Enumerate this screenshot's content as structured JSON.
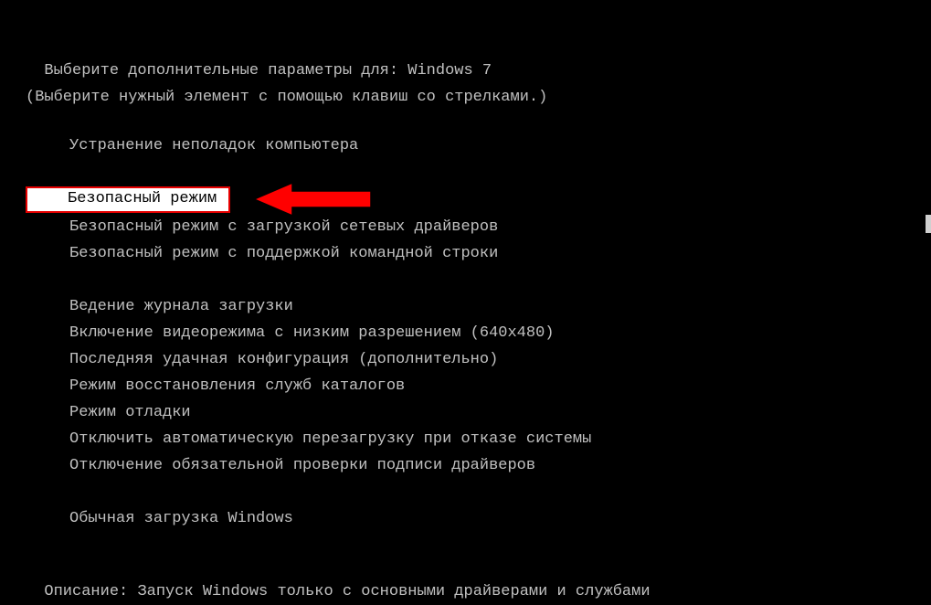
{
  "header": {
    "line1_prefix": "Выберите дополнительные параметры для: ",
    "os_name": "Windows 7",
    "line2": "(Выберите нужный элемент с помощью клавиш со стрелками.)"
  },
  "menu": {
    "repair": "Устранение неполадок компьютера",
    "safe_mode": "Безопасный режим",
    "safe_mode_net": "Безопасный режим с загрузкой сетевых драйверов",
    "safe_mode_cmd": "Безопасный режим с поддержкой командной строки",
    "boot_log": "Ведение журнала загрузки",
    "low_res": "Включение видеорежима с низким разрешением (640x480)",
    "last_known": "Последняя удачная конфигурация (дополнительно)",
    "ds_restore": "Режим восстановления служб каталогов",
    "debug": "Режим отладки",
    "no_auto_restart": "Отключить автоматическую перезагрузку при отказе системы",
    "no_sig": "Отключение обязательной проверки подписи драйверов",
    "normal": "Обычная загрузка Windows"
  },
  "description": {
    "label": "Описание: ",
    "text": "Запуск Windows только с основными драйверами и службами"
  },
  "colors": {
    "accent_red": "#e60000"
  }
}
